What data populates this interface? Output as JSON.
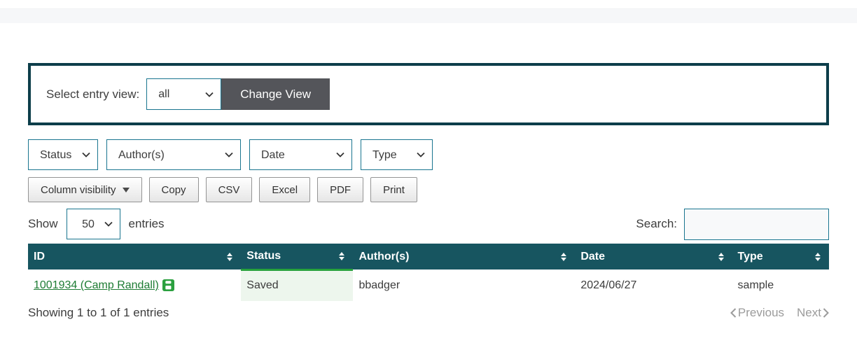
{
  "view_controls": {
    "label": "Select entry view:",
    "view_select_value": "all",
    "change_view_button": "Change View"
  },
  "filters": [
    {
      "label": "Status"
    },
    {
      "label": "Author(s)"
    },
    {
      "label": "Date"
    },
    {
      "label": "Type"
    }
  ],
  "toolbar": {
    "column_visibility": "Column visibility",
    "copy": "Copy",
    "csv": "CSV",
    "excel": "Excel",
    "pdf": "PDF",
    "print": "Print"
  },
  "length_menu": {
    "show_label": "Show",
    "selected": "50",
    "entries_label": "entries"
  },
  "search": {
    "label": "Search:",
    "value": ""
  },
  "table": {
    "columns": [
      {
        "label": "ID"
      },
      {
        "label": "Status"
      },
      {
        "label": "Author(s)"
      },
      {
        "label": "Date"
      },
      {
        "label": "Type"
      }
    ],
    "rows": [
      {
        "id_link": "1001934 (Camp Randall)",
        "status": "Saved",
        "authors": "bbadger",
        "date": "2024/06/27",
        "type": "sample"
      }
    ]
  },
  "pagination": {
    "info": "Showing 1 to 1 of 1 entries",
    "previous": "Previous",
    "next": "Next"
  },
  "colors": {
    "header_teal": "#175560",
    "box_border": "#0d3e4a",
    "accent_border": "#19758f",
    "button_dark": "#54555a",
    "link_green": "#1e7c34",
    "saved_bg": "#edf6ed",
    "saved_border": "#28a23c",
    "save_icon_green": "#2ba03f"
  }
}
